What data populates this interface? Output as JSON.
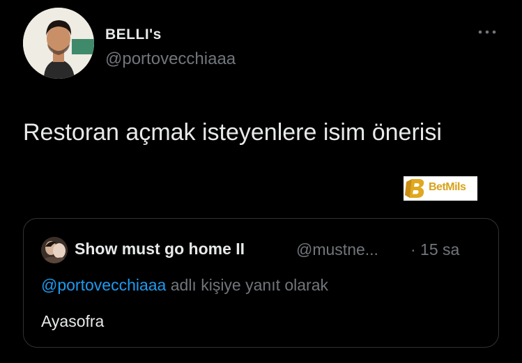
{
  "author": {
    "name": "BELLI's",
    "handle": "@portovecchiaaa",
    "avatar_icon": "profile-photo"
  },
  "tweet": {
    "text": "Restoran açmak isteyenlere isim önerisi"
  },
  "watermark": {
    "text": "BetMils"
  },
  "quoted_tweet": {
    "name": "Show must go home II",
    "handle": "@mustne...",
    "time": "· 15 sa",
    "reply_mention": "@portovecchiaaa",
    "reply_suffix": " adlı kişiye yanıt olarak",
    "text": "Ayasofra"
  },
  "colors": {
    "background": "#000000",
    "primary_text": "#e7e9ea",
    "secondary_text": "#71767b",
    "link": "#1d9bf0",
    "border": "#2f3336"
  }
}
